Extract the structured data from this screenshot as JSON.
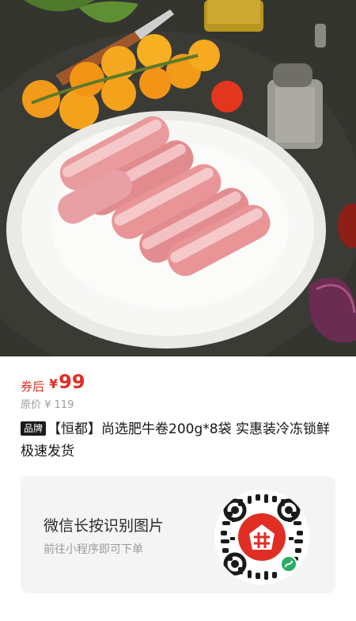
{
  "product": {
    "image_alt_icon": "food-photo-beef-rolls",
    "coupon_label": "券后",
    "currency": "¥",
    "price": "99",
    "original_price": "原价 ¥ 119",
    "brand_badge": "品牌",
    "title": "【恒都】尚选肥牛卷200g*8袋 实惠装冷冻锁鲜 极速发货"
  },
  "qr_card": {
    "title": "微信长按识别图片",
    "subtitle": "前往小程序即可下单",
    "qr_icon": "pinduoduo-miniprogram-qr-icon"
  },
  "colors": {
    "price_red": "#e02e24",
    "brand_red": "#e02e24",
    "card_bg": "#f4f4f4"
  }
}
